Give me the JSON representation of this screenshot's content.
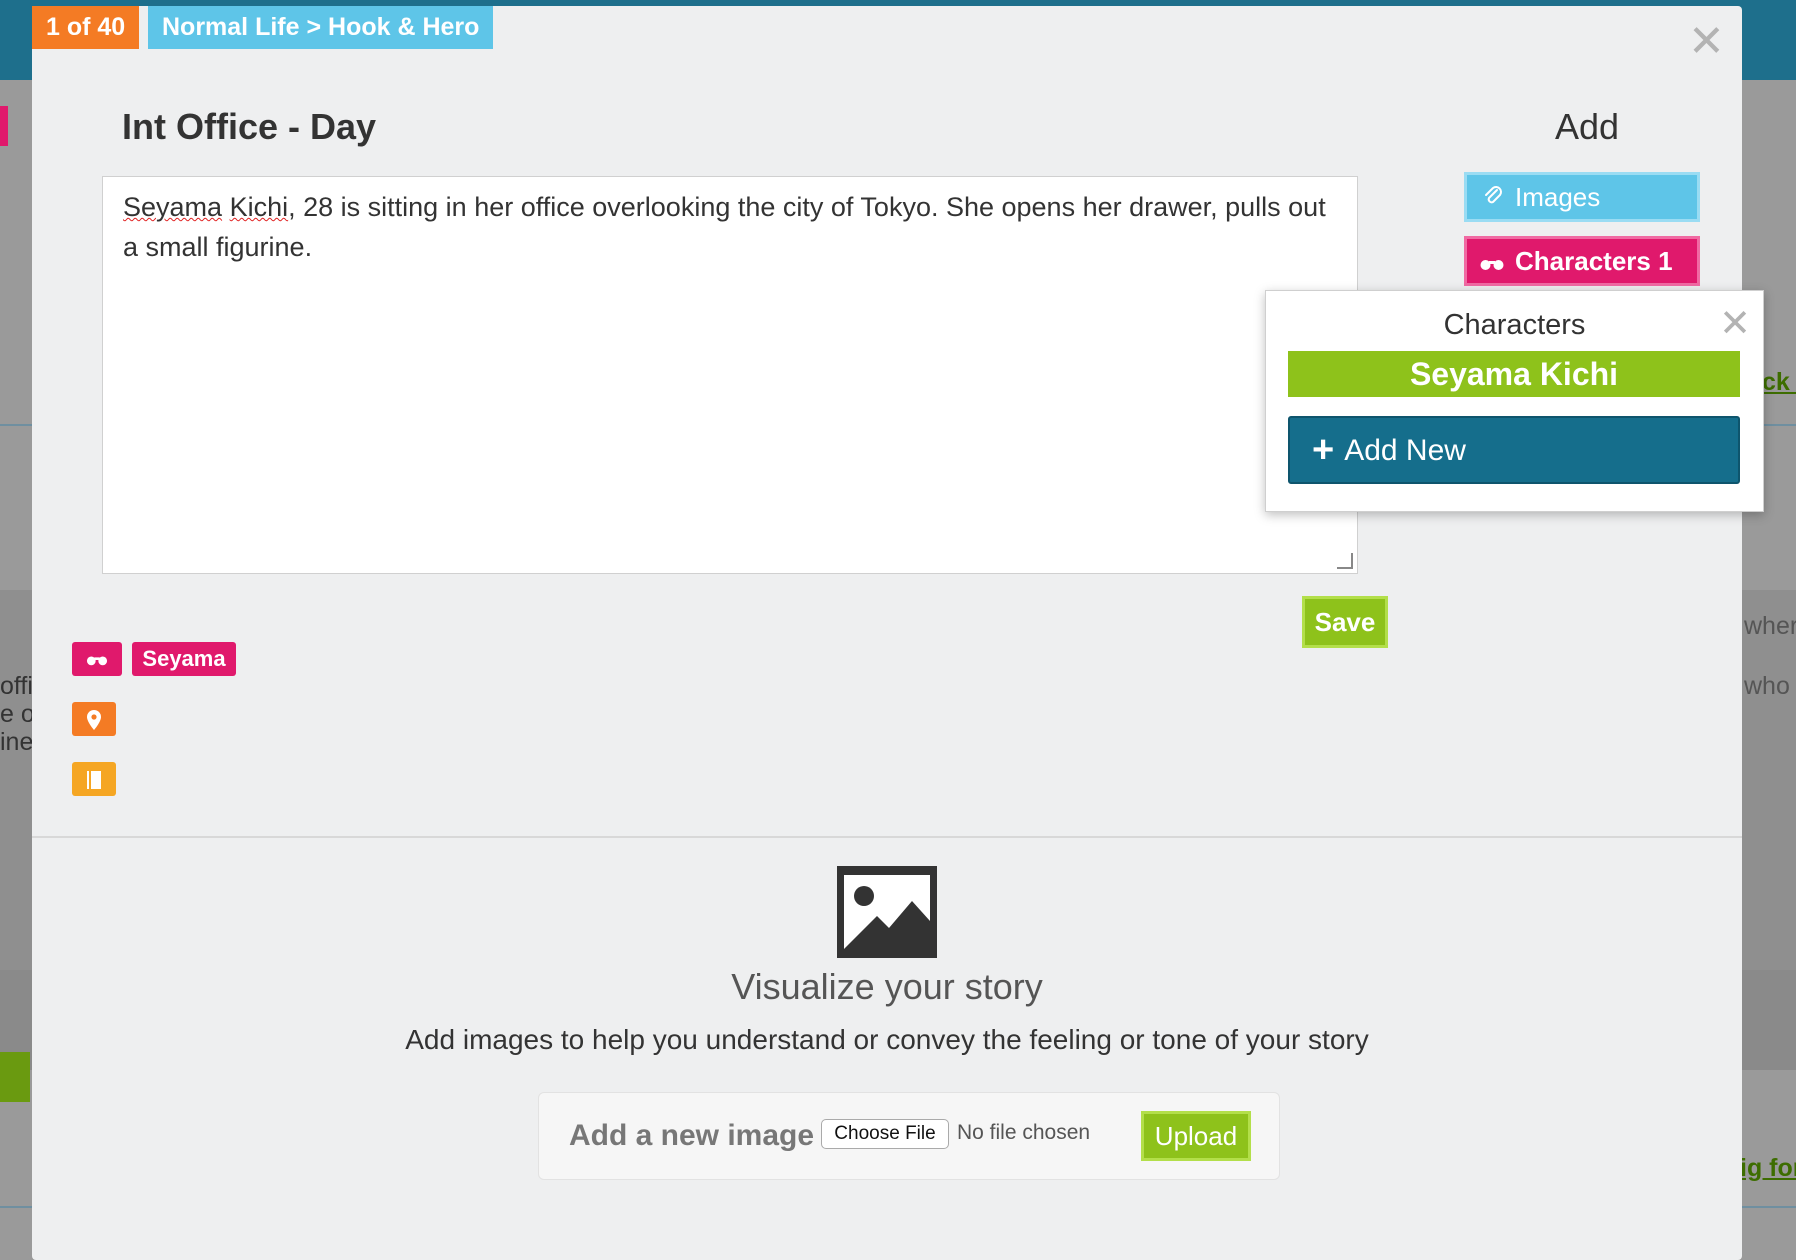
{
  "background": {
    "fragments_left": [
      "offi",
      "e op",
      "ine"
    ],
    "fragments_right": [
      "ck a",
      "wher",
      "who a"
    ],
    "link_right": "ig for"
  },
  "modal": {
    "progress": "1 of 40",
    "breadcrumb": "Normal Life > Hook & Hero",
    "scene_title": "Int Office - Day",
    "add_heading": "Add",
    "scene_text_misspelled_1": "Seyama",
    "scene_text_misspelled_2": "Kichi",
    "scene_text_rest": ", 28 is sitting in her office overlooking the city of Tokyo. She opens her drawer, pulls out a small figurine.",
    "images_button": "Images",
    "characters_button": "Characters 1",
    "save_button": "Save",
    "tags": {
      "character": "Seyama"
    }
  },
  "popover": {
    "title": "Characters",
    "character": "Seyama Kichi",
    "add_new": "Add New"
  },
  "visualize": {
    "title": "Visualize your story",
    "subtitle": "Add images to help you understand or convey the feeling or tone of your story",
    "upload_label": "Add a new image",
    "choose_file": "Choose File",
    "no_file": "No file chosen",
    "upload_button": "Upload"
  },
  "colors": {
    "pink": "#e0196c",
    "blue": "#5ec5e8",
    "orange": "#f47b24",
    "green": "#8ec21b",
    "teal": "#156e8c"
  }
}
